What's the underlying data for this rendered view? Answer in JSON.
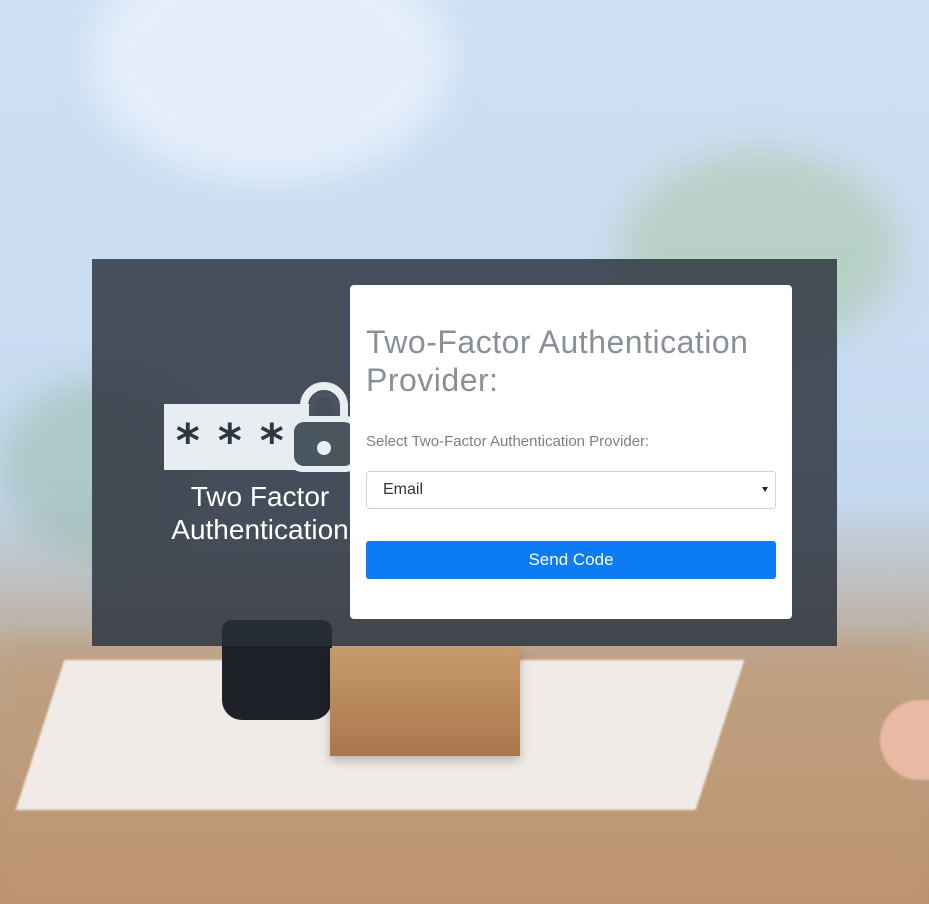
{
  "brand": {
    "password_mask": [
      "*",
      "*",
      "*"
    ],
    "line1": "Two Factor",
    "line2": "Authentication"
  },
  "card": {
    "title": "Two-Factor Authentication Provider:",
    "field_label": "Select Two-Factor Authentication Provider:",
    "selected_provider": "Email",
    "submit_label": "Send Code"
  },
  "icons": {
    "lock": "lock-icon",
    "dropdown": "chevron-down-icon"
  },
  "colors": {
    "overlay": "#28303a",
    "primary_button": "#0d7cf4",
    "title_text": "#8a9096"
  }
}
